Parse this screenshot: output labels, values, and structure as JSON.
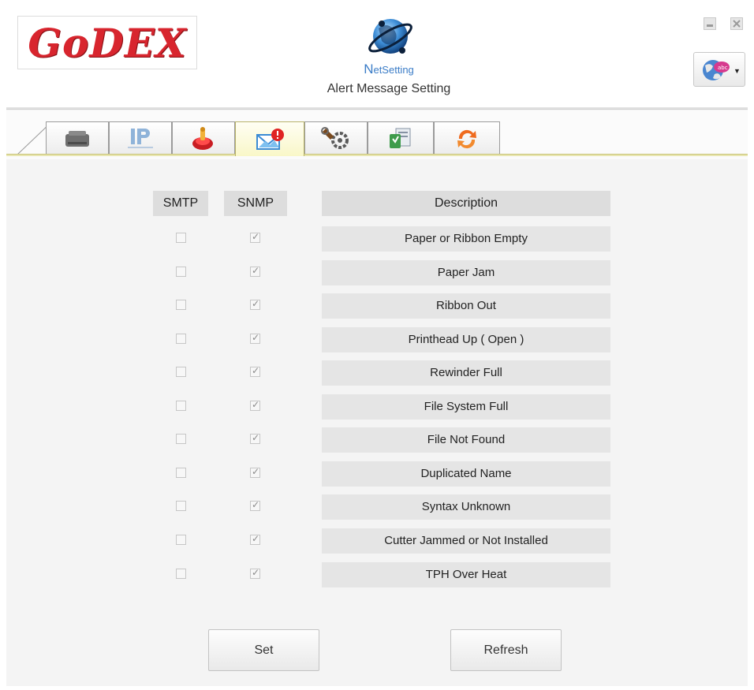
{
  "header": {
    "logo_text": "GoDEX",
    "app_name_first": "N",
    "app_name_rest": "etSetting",
    "page_title": "Alert Message Setting"
  },
  "tabs": [
    {
      "name": "printer-tab",
      "icon": "printer-icon"
    },
    {
      "name": "ip-network-tab",
      "icon": "ip-network-icon"
    },
    {
      "name": "printer-config-tab",
      "icon": "config-icon"
    },
    {
      "name": "alert-message-tab",
      "icon": "alert-envelope-icon",
      "active": true
    },
    {
      "name": "tools-tab",
      "icon": "gears-icon"
    },
    {
      "name": "firmware-tab",
      "icon": "download-icon"
    },
    {
      "name": "restart-tab",
      "icon": "refresh-icon"
    }
  ],
  "columns": {
    "smtp": "SMTP",
    "snmp": "SNMP",
    "description": "Description"
  },
  "alerts": [
    {
      "description": "Paper or Ribbon Empty",
      "smtp": false,
      "snmp": true
    },
    {
      "description": "Paper Jam",
      "smtp": false,
      "snmp": true
    },
    {
      "description": "Ribbon Out",
      "smtp": false,
      "snmp": true
    },
    {
      "description": "Printhead Up ( Open )",
      "smtp": false,
      "snmp": true
    },
    {
      "description": "Rewinder Full",
      "smtp": false,
      "snmp": true
    },
    {
      "description": "File System Full",
      "smtp": false,
      "snmp": true
    },
    {
      "description": "File Not Found",
      "smtp": false,
      "snmp": true
    },
    {
      "description": "Duplicated Name",
      "smtp": false,
      "snmp": true
    },
    {
      "description": "Syntax Unknown",
      "smtp": false,
      "snmp": true
    },
    {
      "description": "Cutter Jammed or Not Installed",
      "smtp": false,
      "snmp": true
    },
    {
      "description": "TPH Over Heat",
      "smtp": false,
      "snmp": true
    }
  ],
  "buttons": {
    "set_label": "Set",
    "refresh_label": "Refresh"
  },
  "colors": {
    "brand_red": "#d8252e",
    "tab_active": "#f9f7c8",
    "app_blue": "#3a7cc7"
  }
}
